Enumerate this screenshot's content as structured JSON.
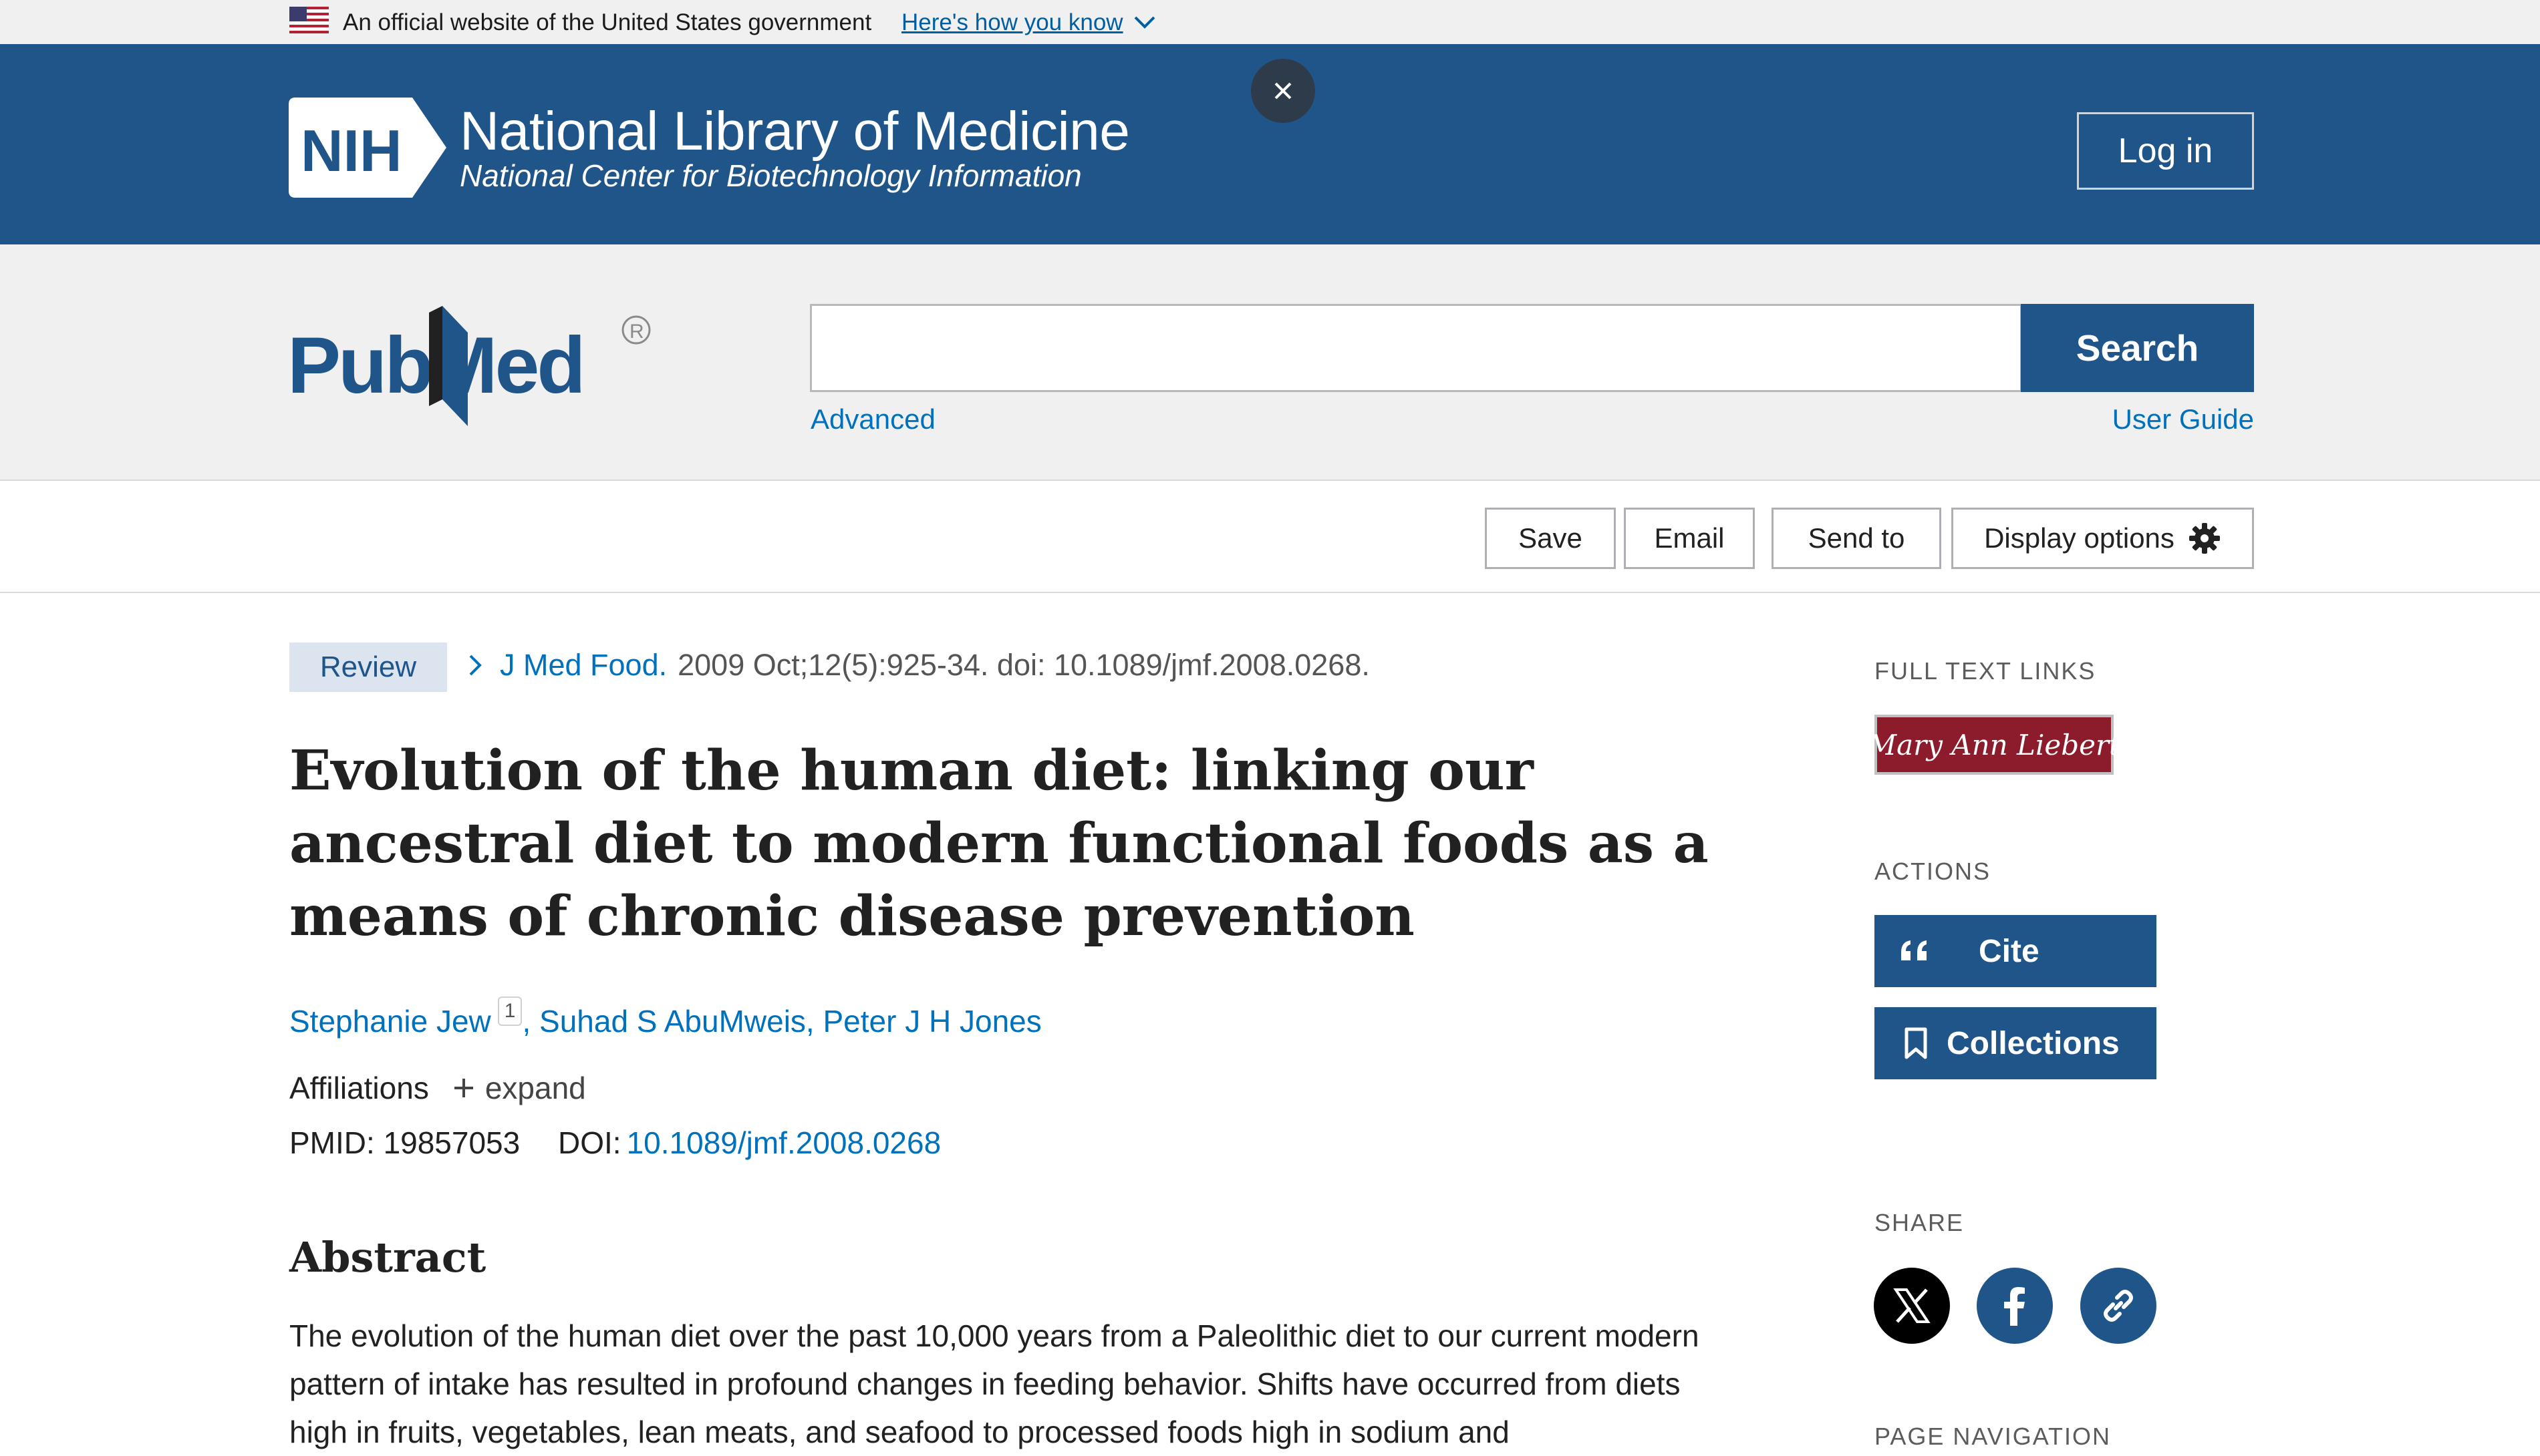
{
  "gov_banner": {
    "text": "An official website of the United States government",
    "link": "Here's how you know"
  },
  "header": {
    "nih_logo_text": "NIH",
    "title": "National Library of Medicine",
    "subtitle": "National Center for Biotechnology Information",
    "login_label": "Log in"
  },
  "search": {
    "logo_text": "PubMed",
    "placeholder": "",
    "button_label": "Search",
    "advanced_label": "Advanced",
    "user_guide_label": "User Guide"
  },
  "toolbar": {
    "save_label": "Save",
    "email_label": "Email",
    "send_to_label": "Send to",
    "display_options_label": "Display options"
  },
  "article": {
    "type_badge": "Review",
    "journal": "J Med Food.",
    "citation": "2009 Oct;12(5):925-34. doi: 10.1089/jmf.2008.0268.",
    "title": "Evolution of the human diet: linking our ancestral diet to modern functional foods as a means of chronic disease prevention",
    "authors": [
      "Stephanie Jew",
      "Suhad S AbuMweis",
      "Peter J H Jones"
    ],
    "first_author_affiliation_ref": "1",
    "affiliations_label": "Affiliations",
    "expand_label": "expand",
    "pmid_label": "PMID:",
    "pmid": "19857053",
    "doi_label": "DOI:",
    "doi": "10.1089/jmf.2008.0268",
    "abstract_heading": "Abstract",
    "abstract_text": "The evolution of the human diet over the past 10,000 years from a Paleolithic diet to our current modern pattern of intake has resulted in profound changes in feeding behavior. Shifts have occurred from diets high in fruits, vegetables, lean meats, and seafood to processed foods high in sodium and"
  },
  "sidebar": {
    "full_text_heading": "FULL TEXT LINKS",
    "publisher_label": "Mary Ann Liebert",
    "actions_heading": "ACTIONS",
    "cite_label": "Cite",
    "collections_label": "Collections",
    "share_heading": "SHARE",
    "page_nav_heading": "PAGE NAVIGATION"
  },
  "colors": {
    "header_blue": "#20558a",
    "link_blue": "#0071bc",
    "banner_gray": "#f0f0f0",
    "publisher_red": "#8c1c2b"
  },
  "icons": [
    "us-flag-icon",
    "chevron-down-icon",
    "close-icon",
    "gear-icon",
    "chevron-right-icon",
    "plus-icon",
    "quote-icon",
    "bookmark-icon",
    "x-logo-icon",
    "facebook-icon",
    "link-icon"
  ]
}
